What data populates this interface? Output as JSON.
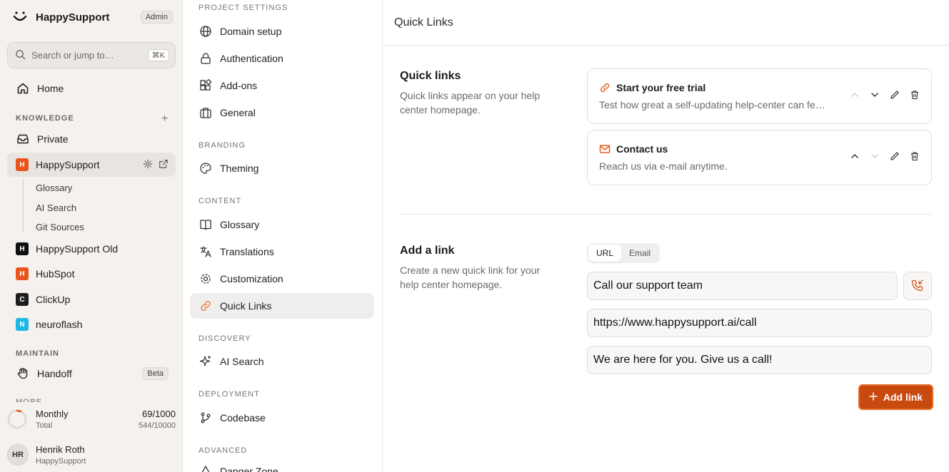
{
  "sidebar": {
    "brand_name": "HappySupport",
    "role_badge": "Admin",
    "search_placeholder": "Search or jump to…",
    "search_shortcut": "⌘K",
    "home_label": "Home",
    "knowledge_label": "KNOWLEDGE",
    "private_label": "Private",
    "spaces": [
      {
        "initial": "H",
        "name": "HappySupport",
        "color": "#e8541c"
      },
      {
        "initial": "H",
        "name": "HappySupport Old",
        "color": "#111111"
      },
      {
        "initial": "H",
        "name": "HubSpot",
        "color": "#e8541c"
      },
      {
        "initial": "C",
        "name": "ClickUp",
        "color": "#1e1e1e"
      },
      {
        "initial": "N",
        "name": "neuroflash",
        "color": "#1fb8e6"
      }
    ],
    "sub_items": [
      "Glossary",
      "AI Search",
      "Git Sources"
    ],
    "maintain_label": "MAINTAIN",
    "handoff_label": "Handoff",
    "handoff_badge": "Beta",
    "more_label": "MORE",
    "usage": {
      "label": "Monthly",
      "sub": "Total",
      "value": "69/1000",
      "total": "544/10000",
      "fraction": 0.069
    },
    "user": {
      "initials": "HR",
      "name": "Henrik Roth",
      "org": "HappySupport"
    }
  },
  "settings": {
    "groups": [
      {
        "label": "PROJECT SETTINGS",
        "items": [
          "Domain setup",
          "Authentication",
          "Add-ons",
          "General"
        ]
      },
      {
        "label": "BRANDING",
        "items": [
          "Theming"
        ]
      },
      {
        "label": "CONTENT",
        "items": [
          "Glossary",
          "Translations",
          "Customization",
          "Quick Links"
        ]
      },
      {
        "label": "DISCOVERY",
        "items": [
          "AI Search"
        ]
      },
      {
        "label": "DEPLOYMENT",
        "items": [
          "Codebase"
        ]
      },
      {
        "label": "ADVANCED",
        "items": [
          "Danger Zone"
        ]
      }
    ]
  },
  "main": {
    "header_title": "Quick Links",
    "quick_links": {
      "title": "Quick links",
      "description": "Quick links appear on your help center homepage.",
      "items": [
        {
          "title": "Start your free trial",
          "description": "Test how great a self-updating help-center can fe…",
          "icon": "link-icon"
        },
        {
          "title": "Contact us",
          "description": "Reach us via e-mail anytime.",
          "icon": "mail-icon"
        }
      ]
    },
    "add_link": {
      "title": "Add a link",
      "description": "Create a new quick link for your help center homepage.",
      "tabs": [
        "URL",
        "Email"
      ],
      "selected_tab": "URL",
      "title_value": "Call our support team",
      "url_value": "https://www.happysupport.ai/call",
      "description_value": "We are here for you. Give us a call!",
      "button_label": "Add link"
    },
    "accent_color": "#c84a10"
  }
}
